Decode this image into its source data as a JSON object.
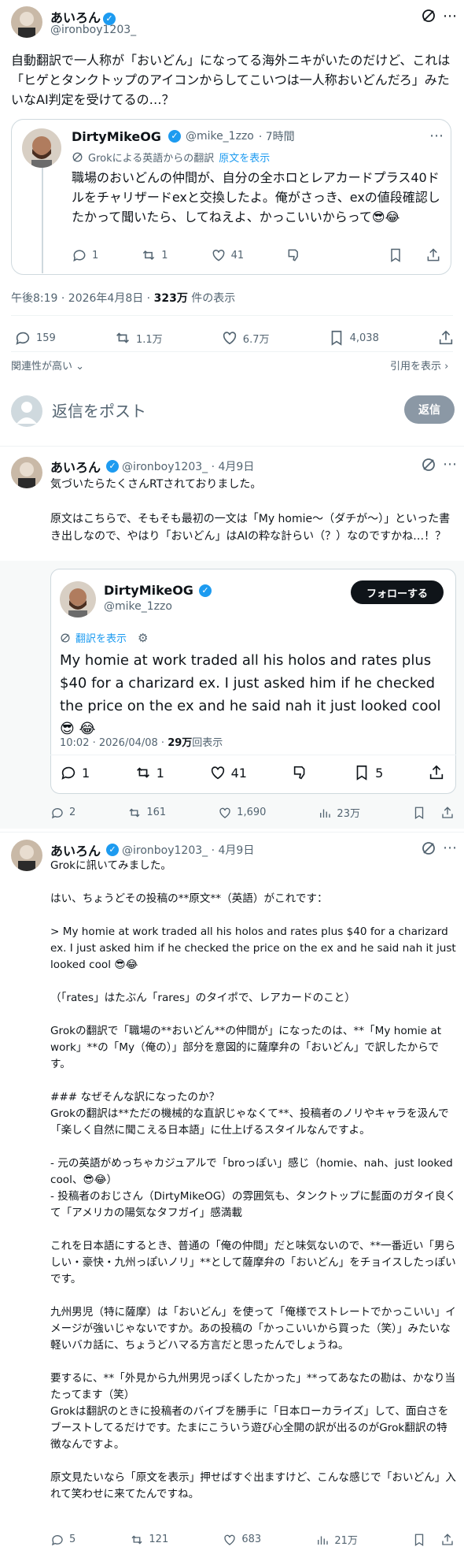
{
  "main": {
    "author_name": "あいろん",
    "author_handle": "@ironboy1203_",
    "text": "自動翻訳で一人称が「おいどん」になってる海外ニキがいたのだけど、これは「ヒゲとタンクトップのアイコンからしてこいつは一人称おいどんだろ」みたいなAI判定を受けてるの…？",
    "meta_time": "午後8:19 · 2026年4月8日 · ",
    "meta_views_num": "323万",
    "meta_views_label": " 件の表示",
    "stats": {
      "replies": "159",
      "reposts": "1.1万",
      "likes": "6.7万",
      "bookmarks": "4,038"
    },
    "sort_label": "関連性が高い",
    "quotes_label": "引用を表示"
  },
  "quoted": {
    "name": "DirtyMikeOG",
    "handle": "@mike_1zzo",
    "time": "· 7時間",
    "grok_label": "Grokによる英語からの翻訳",
    "show_original": "原文を表示",
    "text": "職場のおいどんの仲間が、自分の全ホロとレアカードプラス40ドルをチャリザードexと交換したよ。俺がさっき、exの値段確認したかって聞いたら、してねえよ、かっこいいからって😎😂",
    "stats": {
      "replies": "1",
      "reposts": "1",
      "likes": "41"
    }
  },
  "reply_box": {
    "placeholder": "返信をポスト",
    "button": "返信"
  },
  "reply1": {
    "name": "あいろん",
    "handle": "@ironboy1203_ · 4月9日",
    "text": "気づいたらたくさんRTされておりました。\n\n原文はこちらで、そもそも最初の一文は「My homie～（ダチが～）」といった書き出しなので、やはり「おいどん」はAIの粋な計らい（？）なのですかね…！？",
    "embed": {
      "name": "DirtyMikeOG",
      "handle": "@mike_1zzo",
      "follow": "フォローする",
      "show_translation": "翻訳を表示",
      "text": "My homie at work traded all his holos and rates plus $40 for a charizard ex. I just asked him if he checked the price on the ex and he said nah it just looked cool 😎 😂",
      "meta_time": "10:02 · 2026/04/08 · ",
      "meta_views_num": "29万",
      "meta_views_label": "回表示",
      "stats": {
        "replies": "1",
        "reposts": "1",
        "likes": "41",
        "bookmarks": "5"
      }
    },
    "stats": {
      "replies": "2",
      "reposts": "161",
      "likes": "1,690",
      "views": "23万"
    }
  },
  "reply2": {
    "name": "あいろん",
    "handle": "@ironboy1203_ · 4月9日",
    "text": "Grokに訊いてみました。\n\nはい、ちょうどその投稿の**原文**（英語）がこれです：\n\n> My homie at work traded all his holos and rates plus $40 for a charizard ex. I just asked him if he checked the price on the ex and he said nah it just looked cool 😎😂\n\n（「rates」はたぶん「rares」のタイポで、レアカードのこと）\n\nGrokの翻訳で「職場の**おいどん**の仲間が」になったのは、**「My homie at work」**の「My（俺の）」部分を意図的に薩摩弁の「おいどん」で訳したからです。\n\n### なぜそんな訳になったのか？\nGrokの翻訳は**ただの機械的な直訳じゃなくて**、投稿者のノリやキャラを汲んで「楽しく自然に聞こえる日本語」に仕上げるスタイルなんですよ。\n\n- 元の英語がめっちゃカジュアルで「broっぽい」感じ（homie、nah、just looked cool、😎😂）\n- 投稿者のおじさん（DirtyMikeOG）の雰囲気も、タンクトップに髭面のガタイ良くて「アメリカの陽気なタフガイ」感満載\n\nこれを日本語にするとき、普通の「俺の仲間」だと味気ないので、**一番近い「男らしい・豪快・九州っぽいノリ」**として薩摩弁の「おいどん」をチョイスしたっぽいです。\n\n九州男児（特に薩摩）は「おいどん」を使って「俺様でストレートでかっこいい」イメージが強いじゃないですか。あの投稿の「かっこいいから買った（笑）」みたいな軽いバカ話に、ちょうどハマる方言だと思ったんでしょうね。\n\n要するに、**「外見から九州男児っぽくしたかった」**ってあなたの勘は、かなり当たってます（笑）\nGrokは翻訳のときに投稿者のバイブを勝手に「日本ローカライズ」して、面白さをブーストしてるだけです。たまにこういう遊び心全開の訳が出るのがGrok翻訳の特徴なんですよ。\n\n原文見たいなら「原文を表示」押せばすぐ出ますけど、こんな感じで「おいどん」入れて笑わせに来てたんですね。",
    "stats": {
      "replies": "5",
      "reposts": "121",
      "likes": "683",
      "views": "21万"
    }
  },
  "colors": {
    "accent": "#1d9bf0",
    "muted": "#536471",
    "border": "#cfd9de",
    "reply_btn": "#8b98a5"
  }
}
